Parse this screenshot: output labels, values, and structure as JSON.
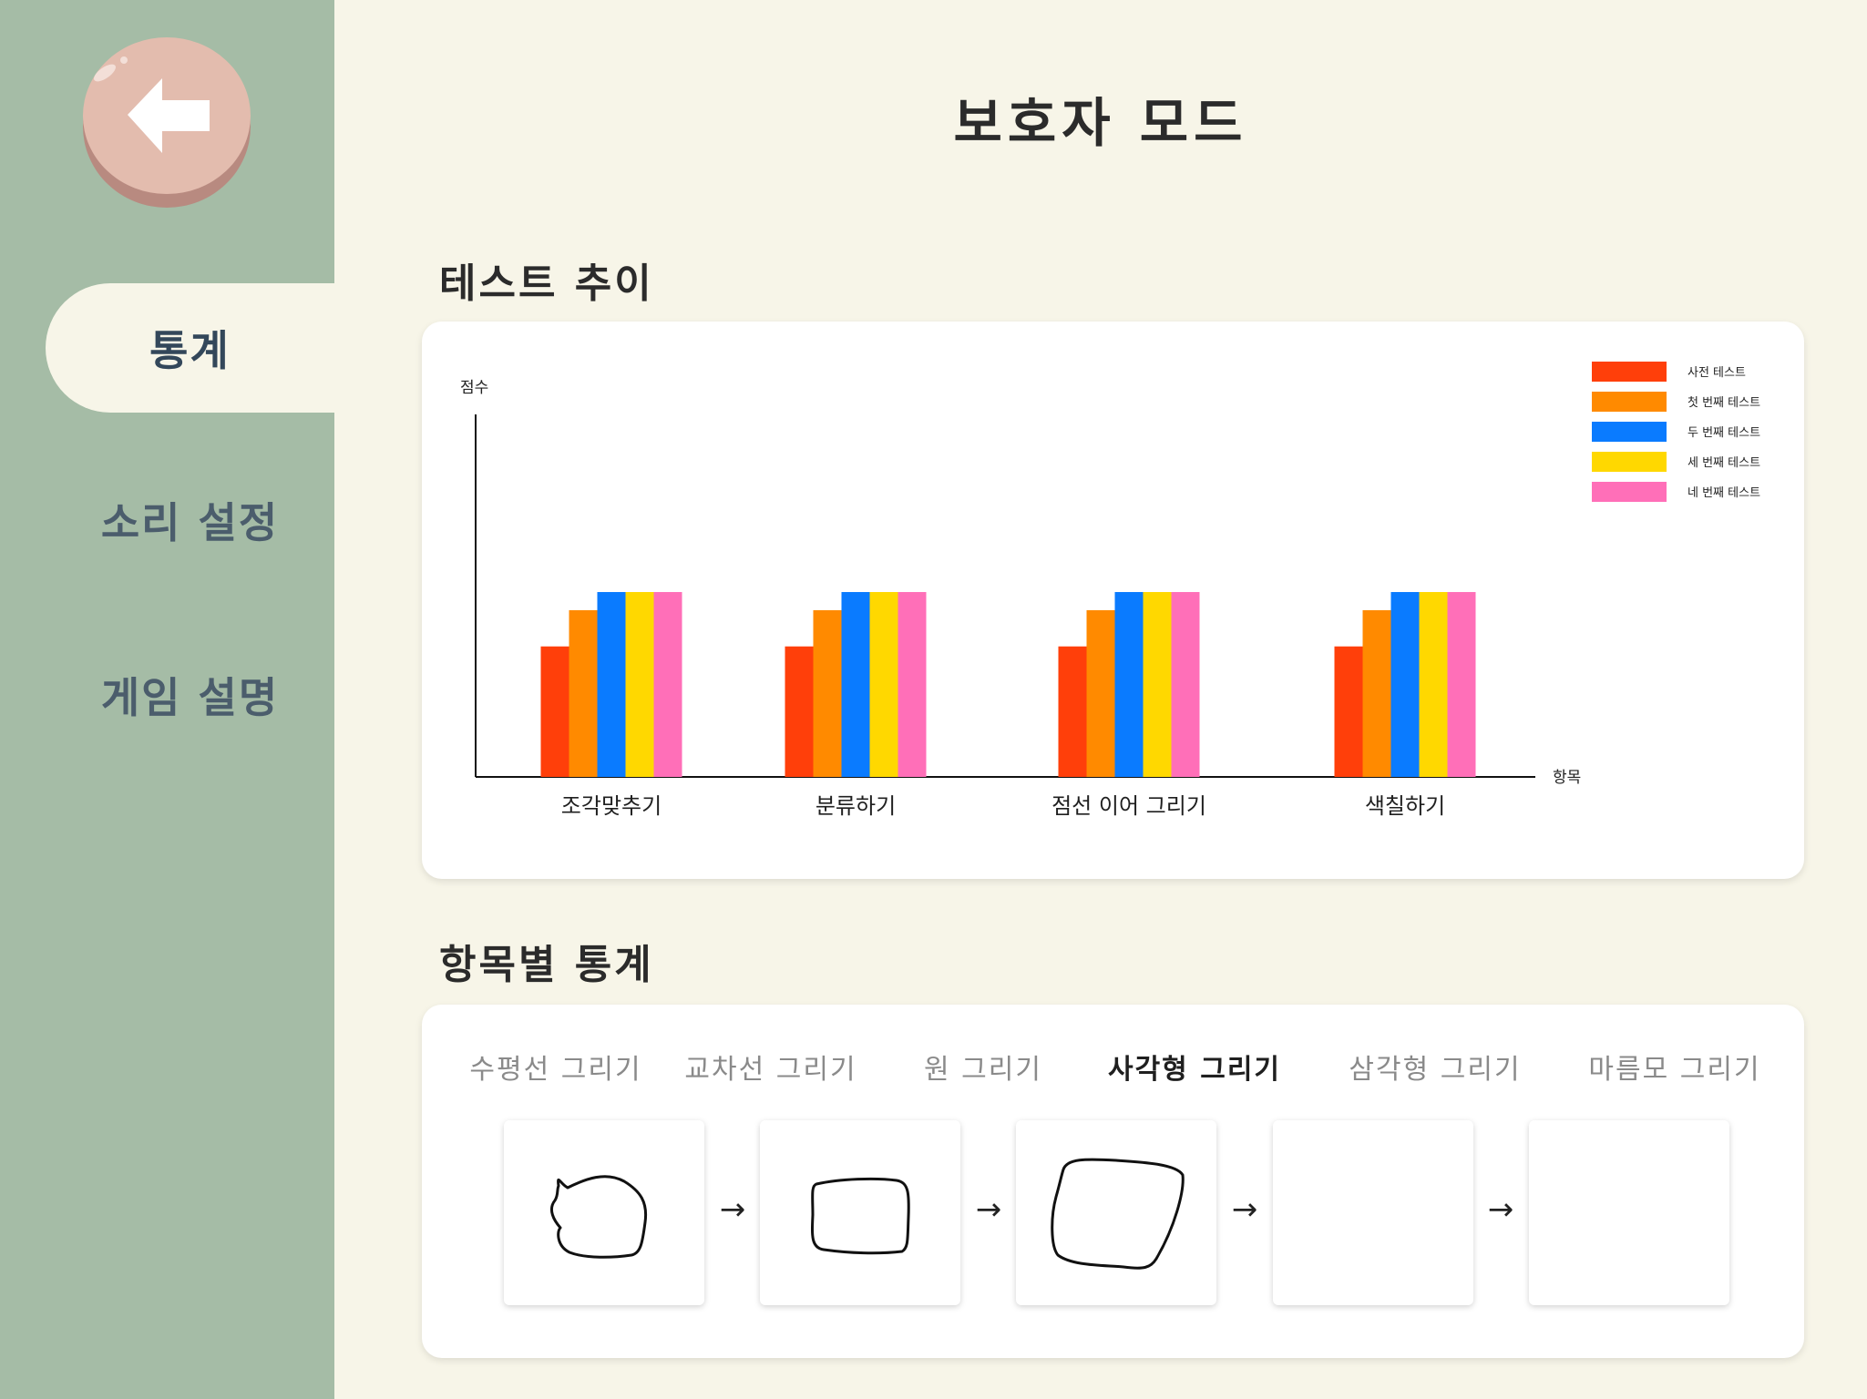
{
  "title": "보호자 모드",
  "back_button": {
    "icon": "left-arrow-icon"
  },
  "sidebar": {
    "items": [
      {
        "label": "통계",
        "active": true
      },
      {
        "label": "소리 설정",
        "active": false
      },
      {
        "label": "게임 설명",
        "active": false
      }
    ]
  },
  "sections": {
    "trend_title": "테스트 추이",
    "item_stats_title": "항목별 통계"
  },
  "colors": {
    "sidebar_bg": "#a5bca6",
    "page_bg": "#f7f5e8",
    "back_button": "#e3bcae"
  },
  "chart_data": {
    "type": "bar",
    "title": "",
    "xlabel": "항목",
    "ylabel": "점수",
    "categories": [
      "조각맞추기",
      "분류하기",
      "점선 이어 그리기",
      "색칠하기"
    ],
    "ylim": [
      0,
      10
    ],
    "series": [
      {
        "name": "사전 테스트",
        "color": "#ff3f0a",
        "values": [
          3.6,
          3.6,
          3.6,
          3.6
        ]
      },
      {
        "name": "첫 번째 테스트",
        "color": "#ff8a00",
        "values": [
          4.6,
          4.6,
          4.6,
          4.6
        ]
      },
      {
        "name": "두 번째 테스트",
        "color": "#0a7bff",
        "values": [
          5.1,
          5.1,
          5.1,
          5.1
        ]
      },
      {
        "name": "세 번째 테스트",
        "color": "#ffd800",
        "values": [
          5.1,
          5.1,
          5.1,
          5.1
        ]
      },
      {
        "name": "네 번째 테스트",
        "color": "#ff6fb8",
        "values": [
          5.1,
          5.1,
          5.1,
          5.1
        ]
      }
    ],
    "legend_position": "top-right",
    "grid": false
  },
  "item_tabs": [
    {
      "label": "수평선 그리기",
      "active": false
    },
    {
      "label": "교차선 그리기",
      "active": false
    },
    {
      "label": "원 그리기",
      "active": false
    },
    {
      "label": "사각형 그리기",
      "active": true
    },
    {
      "label": "삼각형 그리기",
      "active": false
    },
    {
      "label": "마름모 그리기",
      "active": false
    }
  ],
  "drawings": [
    "blob-drawing",
    "rounded-square-drawing",
    "square-drawing",
    "empty",
    "empty"
  ],
  "arrow_symbol": "→"
}
